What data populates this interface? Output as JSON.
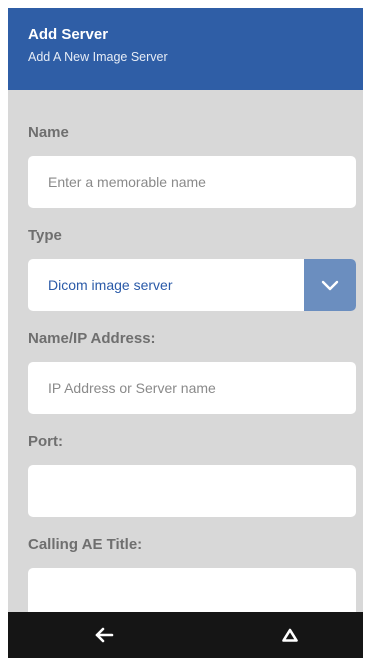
{
  "colors": {
    "header_bg": "#2f5ea6",
    "content_bg": "#d8d8d8",
    "select_button_bg": "#6b8ebf",
    "select_value_text": "#2a5aa8",
    "navbar_bg": "#151515",
    "page_border": "#ffffff"
  },
  "header": {
    "title": "Add Server",
    "subtitle": "Add A New Image Server"
  },
  "form": {
    "name": {
      "label": "Name",
      "placeholder": "Enter a memorable name",
      "value": ""
    },
    "type": {
      "label": "Type",
      "selected": "Dicom image server",
      "icon": "chevron-down-icon"
    },
    "address": {
      "label": "Name/IP Address:",
      "placeholder": "IP Address or Server name",
      "value": ""
    },
    "port": {
      "label": "Port:",
      "placeholder": "",
      "value": ""
    },
    "calling_ae": {
      "label": "Calling AE Title:",
      "placeholder": "",
      "value": ""
    }
  },
  "navbar": {
    "back_icon": "arrow-left-icon",
    "home_icon": "triangle-home-icon"
  }
}
